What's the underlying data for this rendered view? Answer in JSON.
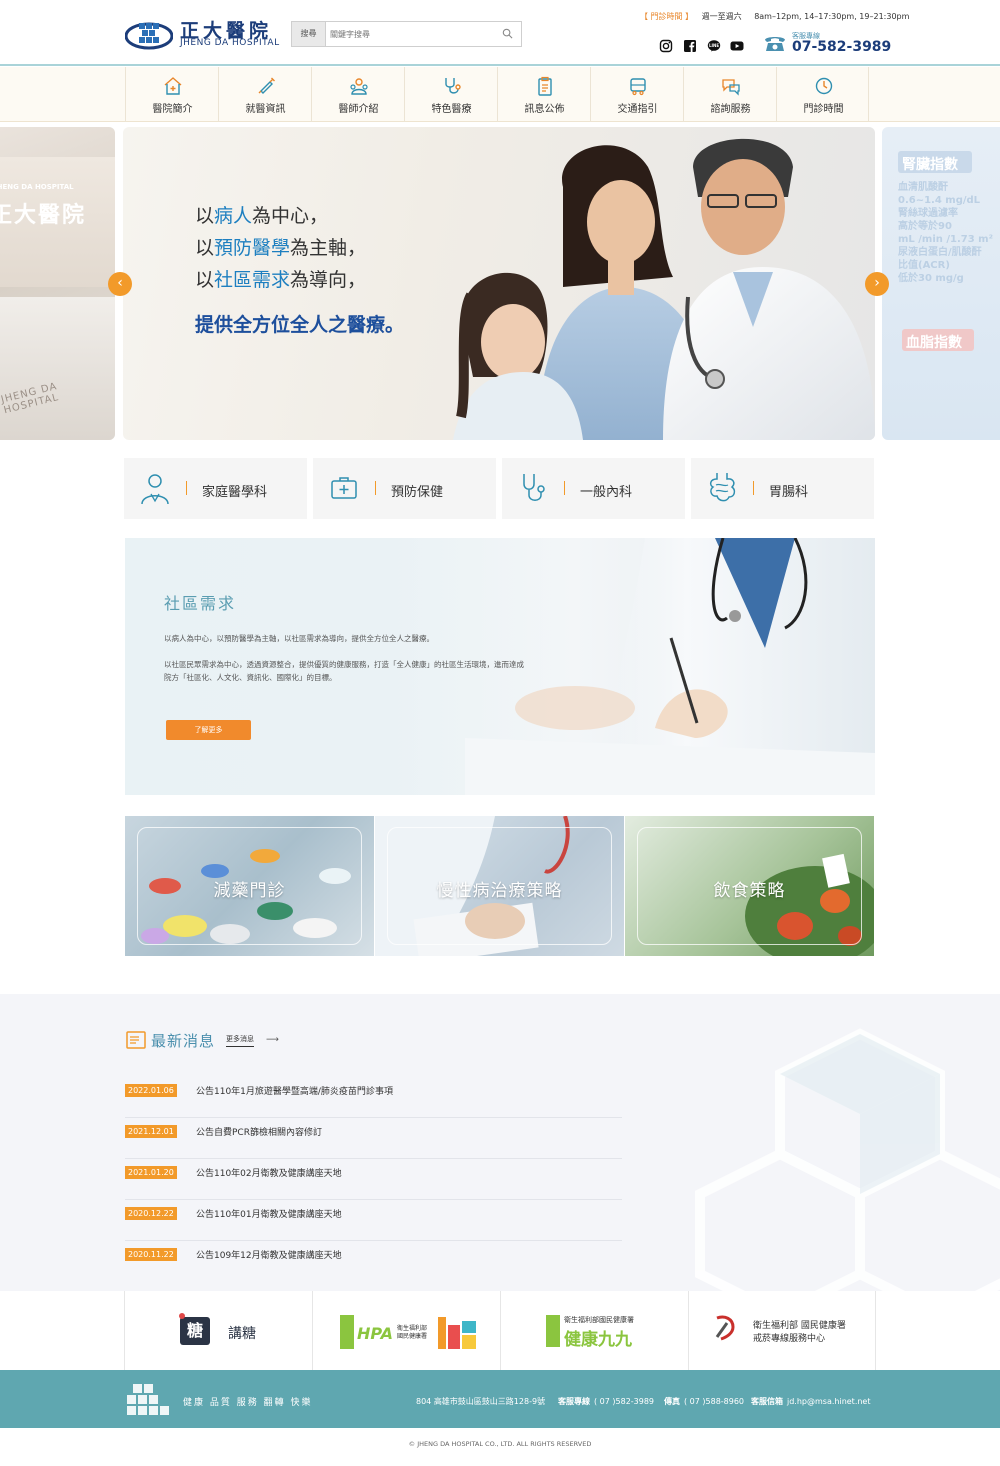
{
  "brand": {
    "name_zh": "正大醫院",
    "name_en": "JHENG DA HOSPITAL"
  },
  "search": {
    "button_label": "搜尋",
    "placeholder": "關鍵字搜尋"
  },
  "header": {
    "hours_label": "【 門診時間 】",
    "hours_days": "週一至週六",
    "hours_times": "8am–12pm, 14–17:30pm, 19–21:30pm",
    "phone_label": "客服專線",
    "phone_number": "07-582-3989",
    "social_icons": [
      "instagram-icon",
      "facebook-icon",
      "line-icon",
      "youtube-icon"
    ]
  },
  "nav": {
    "items": [
      {
        "label": "醫院簡介",
        "icon": "home-plus-icon"
      },
      {
        "label": "就醫資訊",
        "icon": "syringe-icon"
      },
      {
        "label": "醫師介紹",
        "icon": "doctor-group-icon"
      },
      {
        "label": "特色醫療",
        "icon": "stethoscope-icon"
      },
      {
        "label": "訊息公佈",
        "icon": "clipboard-icon"
      },
      {
        "label": "交通指引",
        "icon": "bus-icon"
      },
      {
        "label": "諮詢服務",
        "icon": "chat-bubbles-icon"
      },
      {
        "label": "門診時間",
        "icon": "clock-icon"
      }
    ]
  },
  "hero": {
    "line1_prefix": "以",
    "line1_highlight": "病人",
    "line1_suffix": "為中心，",
    "line2_prefix": "以",
    "line2_highlight": "預防醫學",
    "line2_suffix": "為主軸，",
    "line3_prefix": "以",
    "line3_highlight": "社區需求",
    "line3_suffix": "為導向，",
    "line4": "提供全方位全人之醫療。",
    "side_left_text": "正大醫院",
    "side_left_sub": "JHENG DA HOSPITAL",
    "side_right_title": "腎臟指數",
    "side_right_lines": [
      "血清肌酸酐",
      "0.6~1.4 mg/dL",
      "腎絲球過濾率",
      "高於等於90",
      "mL /min /1.73 m²",
      "尿液白蛋白/肌酸酐",
      "比值(ACR)",
      "低於30 mg/g"
    ],
    "side_right_title2": "血脂指數"
  },
  "services": [
    {
      "label": "家庭醫學科",
      "icon": "doctor-icon"
    },
    {
      "label": "預防保健",
      "icon": "medical-kit-icon"
    },
    {
      "label": "一般內科",
      "icon": "stethoscope-icon"
    },
    {
      "label": "胃腸科",
      "icon": "intestine-icon"
    }
  ],
  "community": {
    "title": "社區需求",
    "p1": "以病人為中心，以預防醫學為主軸，以社區需求為導向，提供全方位全人之醫療。",
    "p2": "以社區民眾需求為中心，透過資源整合，提供優質的健康服務，打造「全人健康」的社區生活環境，進而達成院方「社區化、人文化、資訊化、國際化」的目標。",
    "button": "了解更多"
  },
  "tiles": [
    {
      "label": "減藥門診"
    },
    {
      "label": "慢性病治療策略"
    },
    {
      "label": "飲食策略"
    }
  ],
  "news": {
    "title": "最新消息",
    "more": "更多消息",
    "items": [
      {
        "date": "2022.01.06",
        "text": "公告110年1月旅遊醫學暨高端/肺炎疫苗門診事項"
      },
      {
        "date": "2021.12.01",
        "text": "公告自費PCR篩檢相關內容修訂"
      },
      {
        "date": "2021.01.20",
        "text": "公告110年02月衛教及健康講座天地"
      },
      {
        "date": "2020.12.22",
        "text": "公告110年01月衛教及健康講座天地"
      },
      {
        "date": "2020.11.22",
        "text": "公告109年12月衛教及健康講座天地"
      }
    ]
  },
  "partners": {
    "p1_mark": "糖",
    "p1_label": "講糖",
    "p2_label": "HPA",
    "p2_sub1": "衛生福利部",
    "p2_sub2": "國民健康署",
    "p3_top": "衛生福利部國民健康署",
    "p3_main": "健康九九",
    "p4_line1": "衛生福利部 國民健康署",
    "p4_line2": "戒菸專線服務中心"
  },
  "footer": {
    "slogan": "健康 品質 服務 翻轉 快樂",
    "address": "804 高雄市鼓山區鼓山三路128-9號",
    "service_label": "客服專線",
    "service_value": "( 07 )582-3989",
    "fax_label": "傳真",
    "fax_value": "( 07 )588-8960",
    "email_label": "客服信箱",
    "email_value": "jd.hp@msa.hinet.net",
    "copyright": "© JHENG DA HOSPITAL CO., LTD. ALL RIGHTS RESERVED"
  },
  "colors": {
    "accent_orange": "#f29a2a",
    "brand_navy": "#1c3d7a",
    "teal": "#5fa7b0"
  }
}
